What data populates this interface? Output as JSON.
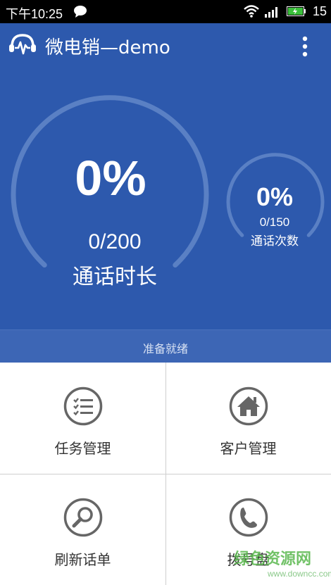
{
  "status_bar": {
    "time": "下午10:25",
    "battery_level": "15",
    "icons": [
      "chat-icon",
      "wifi-icon",
      "signal-icon",
      "battery-icon"
    ]
  },
  "app_bar": {
    "title": "微电销—demo",
    "logo_icon": "headset-logo-icon",
    "menu_icon": "more-vert-icon"
  },
  "stats": {
    "call_duration": {
      "percent_text": "0%",
      "count_text": "0/200",
      "label": "通话时长",
      "progress": 0
    },
    "call_count": {
      "percent_text": "0%",
      "count_text": "0/150",
      "label": "通话次数",
      "progress": 0
    }
  },
  "status": {
    "text": "准备就绪"
  },
  "menu": [
    {
      "label": "任务管理",
      "icon": "task-list-icon"
    },
    {
      "label": "客户管理",
      "icon": "home-icon"
    },
    {
      "label": "刷新话单",
      "icon": "search-icon"
    },
    {
      "label": "拨号盘",
      "icon": "phone-icon"
    }
  ],
  "watermark": {
    "text": "绿色资源网",
    "url": "www.downcc.com"
  },
  "colors": {
    "header_bg": "#2d59ad",
    "status_strip_bg": "#3d66b5",
    "icon_gray": "#666666"
  }
}
